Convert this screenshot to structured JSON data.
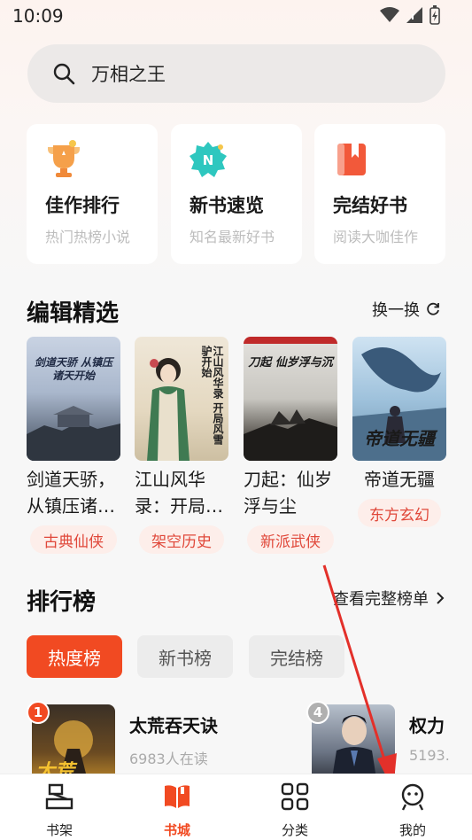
{
  "status": {
    "time": "10:09"
  },
  "search": {
    "text": "万相之王"
  },
  "quick": [
    {
      "title": "佳作排行",
      "subtitle": "热门热榜小说"
    },
    {
      "title": "新书速览",
      "subtitle": "知名最新好书"
    },
    {
      "title": "完结好书",
      "subtitle": "阅读大咖佳作"
    }
  ],
  "editor": {
    "title": "编辑精选",
    "swap": "换一换",
    "books": [
      {
        "title_line1": "剑道天骄，",
        "title_line2": "从镇压诸…",
        "cover_text": "剑道天骄 从镇压诸天开始",
        "tag": "古典仙侠"
      },
      {
        "title_line1": "江山风华",
        "title_line2": "录：开局…",
        "cover_text": "江山风华录 开局风雪驴开始",
        "tag": "架空历史"
      },
      {
        "title_line1": "刀起：仙岁",
        "title_line2": "浮与尘",
        "cover_text": "刀起 仙岁浮与沉",
        "tag": "新派武侠"
      },
      {
        "title_line1": "帝道无疆",
        "title_line2": "",
        "cover_text": "帝道无疆",
        "tag": "东方玄幻"
      }
    ]
  },
  "ranking": {
    "title": "排行榜",
    "full": "查看完整榜单",
    "tabs": [
      "热度榜",
      "新书榜",
      "完结榜"
    ],
    "items": [
      {
        "rank": "1",
        "name": "太荒吞天诀",
        "readers": "6983人在读",
        "cover_text": "太荒"
      },
      {
        "rank": "4",
        "name": "权力",
        "readers": "5193.",
        "cover_text": ""
      }
    ]
  },
  "nav": [
    {
      "label": "书架",
      "icon": "bookshelf-icon"
    },
    {
      "label": "书城",
      "icon": "book-open-icon"
    },
    {
      "label": "分类",
      "icon": "grid-icon"
    },
    {
      "label": "我的",
      "icon": "user-smile-icon"
    }
  ],
  "colors": {
    "accent": "#f14a22",
    "tag_bg": "#fdeeea",
    "tag_text": "#e0483a"
  }
}
